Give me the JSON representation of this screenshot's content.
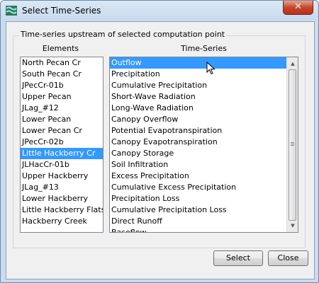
{
  "window": {
    "title": "Select Time-Series",
    "close_label": "✕"
  },
  "group": {
    "label": "Time-series upstream of selected computation point"
  },
  "elements": {
    "header": "Elements",
    "items": [
      "North Pecan Cr",
      "South Pecan Cr",
      "JPecCr-01b",
      "Upper Pecan",
      "JLag_#12",
      "Lower Pecan",
      "Lower Pecan Cr",
      "JPecCr-02b",
      "Little Hackberry Cr",
      "JLHacCr-01b",
      "Upper Hackberry",
      "JLag_#13",
      "Lower Hackberry",
      "Little Hackberry Flats",
      "Hackberry Creek"
    ],
    "selected": "Little Hackberry Cr"
  },
  "timeseries": {
    "header": "Time-Series",
    "items": [
      "Outflow",
      "Precipitation",
      "Cumulative Precipitation",
      "Short-Wave Radiation",
      "Long-Wave Radiation",
      "Canopy Overflow",
      "Potential Evapotranspiration",
      "Canopy Evapotranspiration",
      "Canopy Storage",
      "Soil Infiltration",
      "Excess Precipitation",
      "Cumulative Excess Precipitation",
      "Precipitation Loss",
      "Cumulative Precipitation Loss",
      "Direct Runoff",
      "Baseflow"
    ],
    "selected": "Outflow"
  },
  "buttons": {
    "select": "Select",
    "close": "Close"
  },
  "colors": {
    "selection": "#3399ff",
    "close_button": "#c8452c"
  }
}
